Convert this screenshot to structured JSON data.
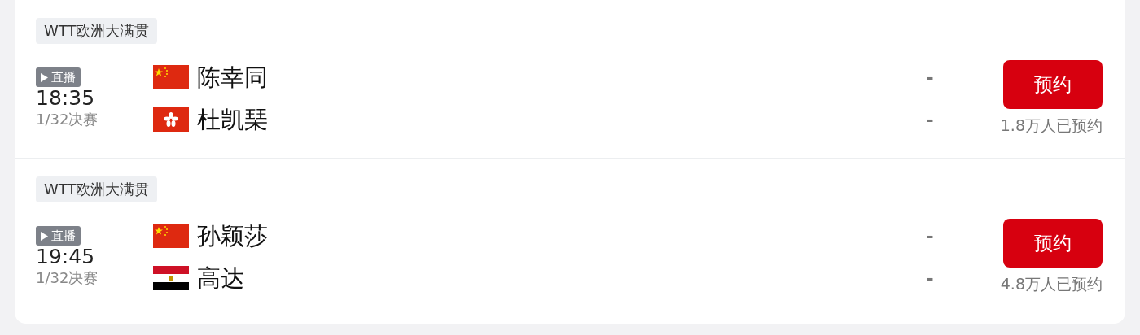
{
  "matches": [
    {
      "event": "WTT欧洲大满贯",
      "live_badge": "直播",
      "time": "18:35",
      "stage": "1/32决赛",
      "players": [
        {
          "kind": "china",
          "name": "陈幸同",
          "score": "-"
        },
        {
          "kind": "hongkong",
          "name": "杜凯琹",
          "score": "-"
        }
      ],
      "button": "预约",
      "reservations": "1.8万人已预约"
    },
    {
      "event": "WTT欧洲大满贯",
      "live_badge": "直播",
      "time": "19:45",
      "stage": "1/32决赛",
      "players": [
        {
          "kind": "china",
          "name": "孙颖莎",
          "score": "-"
        },
        {
          "kind": "egypt",
          "name": "高达",
          "score": "-"
        }
      ],
      "button": "预约",
      "reservations": "4.8万人已预约"
    }
  ]
}
